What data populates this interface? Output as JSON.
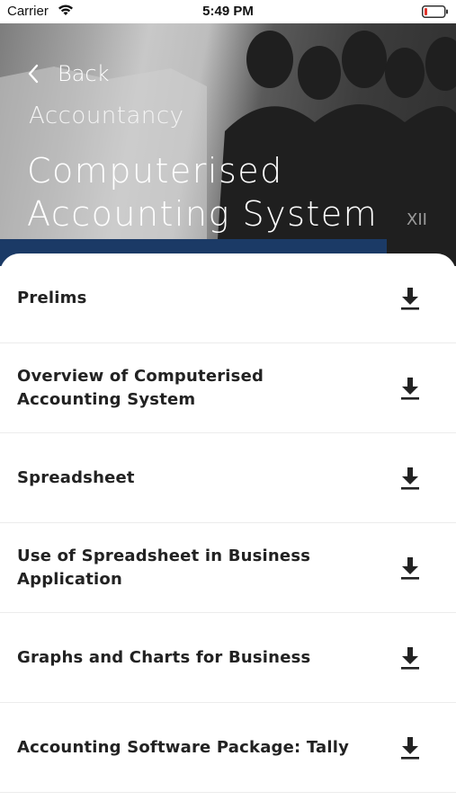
{
  "status_bar": {
    "carrier": "Carrier",
    "time": "5:49 PM"
  },
  "header": {
    "back_label": "Back",
    "subject": "Accountancy",
    "title": "Computerised Accounting System",
    "cover_text": "XII"
  },
  "chapters": [
    {
      "title": "Prelims",
      "icon": "download-icon"
    },
    {
      "title": "Overview of Computerised Accounting System",
      "icon": "download-icon"
    },
    {
      "title": "Spreadsheet",
      "icon": "download-icon"
    },
    {
      "title": "Use of Spreadsheet in Business Application",
      "icon": "download-icon"
    },
    {
      "title": "Graphs and Charts for Business",
      "icon": "download-icon"
    },
    {
      "title": "Accounting Software Package: Tally",
      "icon": "download-icon"
    }
  ],
  "colors": {
    "text": "#222222",
    "divider": "#ececec",
    "header_text": "#ffffff"
  }
}
